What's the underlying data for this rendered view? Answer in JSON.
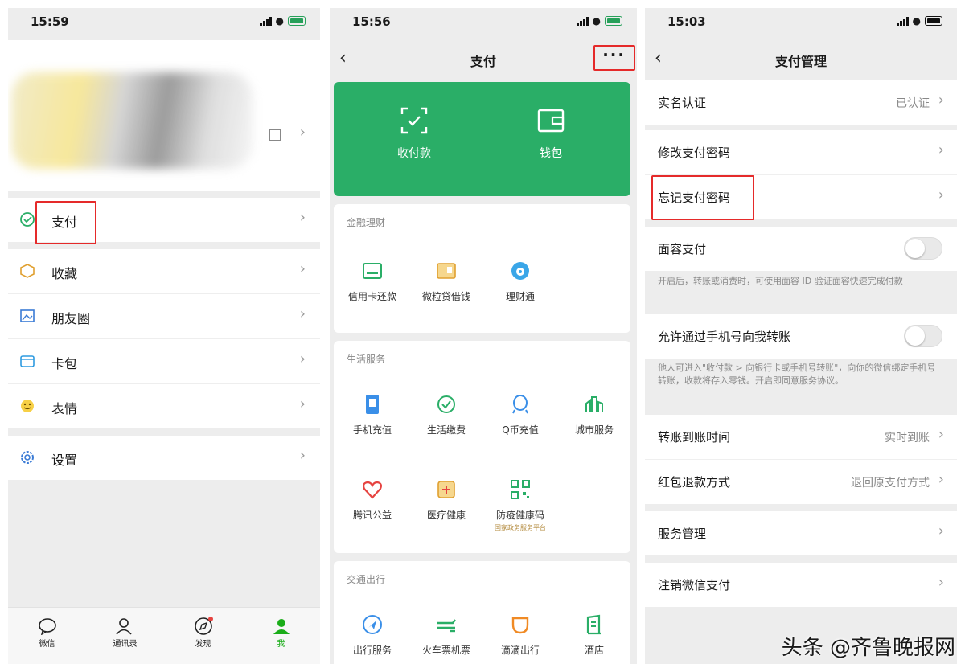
{
  "screen1": {
    "time": "15:59",
    "menu_top": [
      {
        "label": "支付",
        "icon": "pay-icon"
      }
    ],
    "menu_mid": [
      {
        "label": "收藏",
        "icon": "favorites-icon"
      },
      {
        "label": "朋友圈",
        "icon": "moments-icon"
      },
      {
        "label": "卡包",
        "icon": "card-wallet-icon"
      },
      {
        "label": "表情",
        "icon": "sticker-icon"
      }
    ],
    "menu_bottom": [
      {
        "label": "设置",
        "icon": "settings-icon"
      }
    ],
    "tabs": [
      {
        "label": "微信",
        "icon": "chat-icon"
      },
      {
        "label": "通讯录",
        "icon": "contacts-icon"
      },
      {
        "label": "发现",
        "icon": "discover-icon"
      },
      {
        "label": "我",
        "icon": "me-icon"
      }
    ]
  },
  "screen2": {
    "time": "15:56",
    "title": "支付",
    "more": "···",
    "card": [
      {
        "label": "收付款",
        "icon": "scan-receive-icon"
      },
      {
        "label": "钱包",
        "icon": "wallet-icon"
      }
    ],
    "sections": [
      {
        "title": "金融理财",
        "items": [
          {
            "label": "信用卡还款",
            "icon": "credit-card-icon"
          },
          {
            "label": "微粒贷借钱",
            "icon": "loan-icon"
          },
          {
            "label": "理财通",
            "icon": "wealth-icon"
          }
        ]
      },
      {
        "title": "生活服务",
        "items": [
          {
            "label": "手机充值",
            "icon": "phone-topup-icon"
          },
          {
            "label": "生活缴费",
            "icon": "utility-bill-icon"
          },
          {
            "label": "Q币充值",
            "icon": "qcoin-icon"
          },
          {
            "label": "城市服务",
            "icon": "city-service-icon"
          },
          {
            "label": "腾讯公益",
            "icon": "charity-icon"
          },
          {
            "label": "医疗健康",
            "icon": "medical-icon"
          },
          {
            "label": "防疫健康码",
            "icon": "health-code-icon",
            "sub": "国家政务服务平台"
          }
        ]
      },
      {
        "title": "交通出行",
        "items": [
          {
            "label": "出行服务",
            "icon": "travel-icon"
          },
          {
            "label": "火车票机票",
            "icon": "train-ticket-icon"
          },
          {
            "label": "滴滴出行",
            "icon": "didi-icon"
          },
          {
            "label": "酒店",
            "icon": "hotel-icon"
          }
        ]
      }
    ]
  },
  "screen3": {
    "time": "15:03",
    "title": "支付管理",
    "rows": {
      "realname": {
        "label": "实名认证",
        "value": "已认证"
      },
      "change_pwd": {
        "label": "修改支付密码"
      },
      "forgot_pwd": {
        "label": "忘记支付密码"
      },
      "face_pay": {
        "label": "面容支付",
        "desc": "开启后，转账或消费时，可使用面容 ID 验证面容快速完成付款"
      },
      "phone_transfer": {
        "label": "允许通过手机号向我转账",
        "desc": "他人可进入\"收付款 > 向银行卡或手机号转账\"，向你的微信绑定手机号转账，收款将存入零钱。开启即同意服务协议。"
      },
      "arrival_time": {
        "label": "转账到账时间",
        "value": "实时到账"
      },
      "refund": {
        "label": "红包退款方式",
        "value": "退回原支付方式"
      },
      "service": {
        "label": "服务管理"
      },
      "close": {
        "label": "注销微信支付"
      }
    }
  },
  "watermark": "头条 @齐鲁晚报网",
  "colors": {
    "green": "#2aae67",
    "highlight": "#e52a2a",
    "bg": "#ededed"
  }
}
